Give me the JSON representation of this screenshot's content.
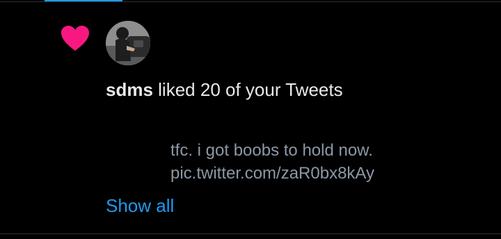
{
  "notification": {
    "username": "sdms",
    "action_text": "liked 20 of your Tweets",
    "tweet_text_line1": "tfc. i got boobs to hold now.",
    "tweet_text_line2": "pic.twitter.com/zaR0bx8kAy",
    "show_all_label": "Show all",
    "icon": "heart-icon",
    "avatar_icon": "avatar"
  },
  "colors": {
    "background": "#000000",
    "heart": "#f91880",
    "link": "#1d9bf0",
    "primary_text": "#e7e9ea",
    "secondary_text": "#8b98a5",
    "divider": "#2f3336"
  }
}
